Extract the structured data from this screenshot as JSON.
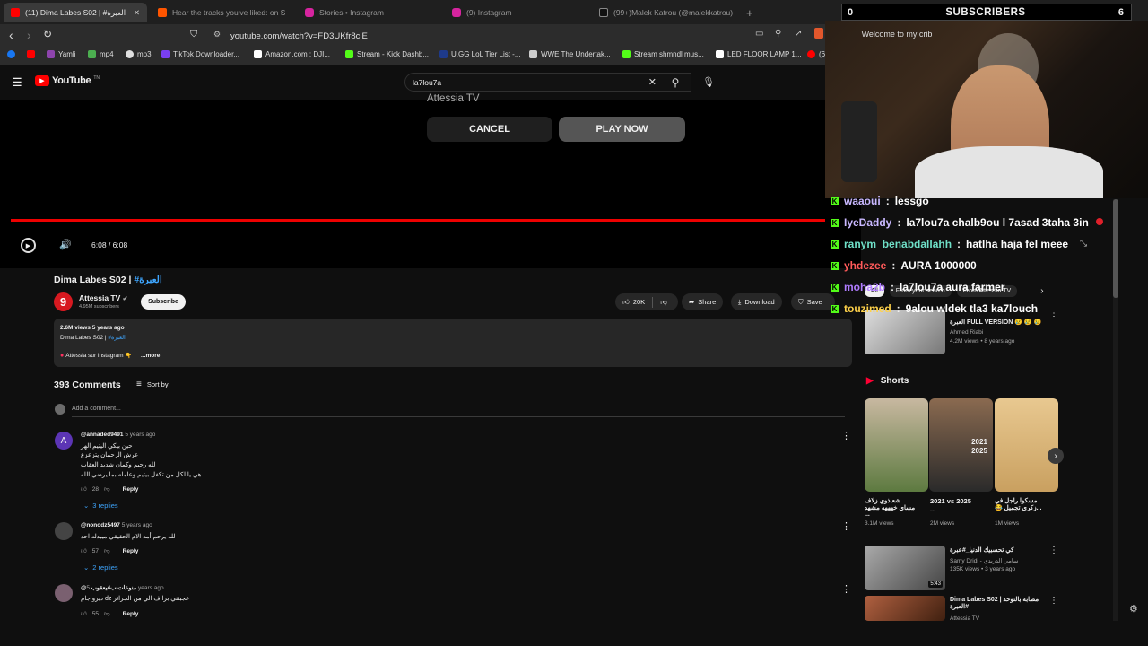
{
  "tabs": [
    {
      "label": "(11) Dima Labes S02 | #العبرة"
    },
    {
      "label": "Hear the tracks you've liked: on S"
    },
    {
      "label": "Stories • Instagram"
    },
    {
      "label": "(9) Instagram"
    },
    {
      "label": "(99+)Malek Katrou (@malekkatrou) |"
    },
    {
      "label": "+"
    }
  ],
  "address": {
    "url": "youtube.com/watch?v=FD3UKfr8clE"
  },
  "bookmarks": [
    {
      "label": "Yamli",
      "color": "#8e44ad"
    },
    {
      "label": "mp4",
      "color": "#4caf50"
    },
    {
      "label": "mp3",
      "color": "#e0e0e0"
    },
    {
      "label": "TikTok Downloader...",
      "color": "#7a3ff2"
    },
    {
      "label": "Amazon.com : DJI...",
      "color": "#ffffff"
    },
    {
      "label": "Stream - Kick Dashb...",
      "color": "#53fc18"
    },
    {
      "label": "U.GG LoL Tier List -...",
      "color": "#1e3a8a"
    },
    {
      "label": "WWE The Undertak...",
      "color": "#cccccc"
    },
    {
      "label": "Stream shmndl mus...",
      "color": "#53fc18"
    },
    {
      "label": "LED FLOOR LAMP 1...",
      "color": "#ffffff"
    }
  ],
  "bookmark_tail": "(6",
  "yt": {
    "logo": "YouTube",
    "logo_sup": "TN",
    "search_value": "la7lou7a"
  },
  "player": {
    "upnext_channel": "Attessia TV",
    "cancel": "CANCEL",
    "play_now": "PLAY NOW",
    "time": "6:08 / 6:08",
    "progress_fraction": 1.0
  },
  "video": {
    "title_prefix": "Dima Labes S02 | ",
    "title_tag": "#العبرة",
    "channel": "Attessia TV",
    "channel_badge": "9",
    "subscribers": "4.95M subscribers",
    "subscribe": "Subscribe",
    "likes": "20K",
    "share": "Share",
    "download": "Download",
    "save": "Save",
    "views": "2.6M views  5 years ago",
    "desc_line": "Dima Labes S02 | ",
    "desc_tag": "#العبرة",
    "desc_insta": "Attessia sur instagram",
    "more": "...more"
  },
  "comments": {
    "count": "393 Comments",
    "sort": "Sort by",
    "add_placeholder": "Add a comment...",
    "items": [
      {
        "avatar": "A",
        "avatar_color": "#5c35b5",
        "user": "@annaded9491",
        "time": "5 years ago",
        "lines": [
          "حين بيكي اليتيم الهر",
          "عرش الرحمان يتزعزع",
          "لله رحيم وكمان شديد العقاب",
          "هي يا لكل من تكفل بيتيم وعامله بما يرضي الله"
        ],
        "likes": "28",
        "reply": "Reply",
        "replies": "3 replies"
      },
      {
        "avatar": "",
        "avatar_color": "#444444",
        "user": "@nonodz5497",
        "time": "5 years ago",
        "lines": [
          "لله يرحم أمه   الام الحقيقي ميبدله احد"
        ],
        "likes": "57",
        "reply": "Reply",
        "replies": "2 replies"
      },
      {
        "avatar": "",
        "avatar_color": "#7a6070",
        "user": "@منوعات-ب4يعقوب",
        "time": "5 years ago",
        "lines": [
          "عجبتني بزااف الي من الجزائر dz ديرو جام"
        ],
        "likes": "55",
        "reply": "Reply",
        "replies": ""
      }
    ]
  },
  "overlay": {
    "left_count": "0",
    "label": "SUBSCRIBERS",
    "right_count": "6",
    "sign": "Welcome to my crib"
  },
  "chat": [
    {
      "user": "waaoui",
      "msg": "lessgo",
      "color": "#c9b8ff"
    },
    {
      "user": "IyeDaddy",
      "msg": "la7lou7a chalb9ou l 7asad 3taha 3in",
      "color": "#c9b8ff"
    },
    {
      "user": "ranym_benabdallahh",
      "msg": "hatlha haja fel meee",
      "color": "#6fe0c8"
    },
    {
      "user": "yhdezee",
      "msg": "AURA 1000000",
      "color": "#ff5a5a"
    },
    {
      "user": "moha2b",
      "msg": "la7lou7a aura farmer",
      "color": "#b07cff"
    },
    {
      "user": "touzimed",
      "msg": "9alou wldek tla3 ka7louch",
      "color": "#ffd24a"
    }
  ],
  "sidebar": {
    "chips": [
      "All",
      "From your search",
      "From Attessia TV"
    ],
    "video1": {
      "title": "العبرة FULL VERSION 😢 😢 😢",
      "channel": "Ahmed Riabi",
      "meta": "4.2M views • 8 years ago"
    },
    "shorts_title": "Shorts",
    "shorts": [
      {
        "title": "شعاذوي زلاف مساي خهههه مشهد ...",
        "views": "3.1M views",
        "color": "#c8b8a0"
      },
      {
        "title": "2021 vs 2025 ...",
        "views": "2M views",
        "color": "#8a6a50",
        "overlay": "2021 2025"
      },
      {
        "title": "مسكوا راجل في ...زكرى تجميل 😂",
        "views": "1M views",
        "color": "#e8c890"
      }
    ],
    "video2": {
      "title": "كي تحسبيك الدنيا_#عبرة",
      "channel": "Samy Dridi - سامي الدريدي",
      "meta": "135K views • 3 years ago",
      "duration": "5:43"
    },
    "video3": {
      "title": "Dima Labes S02 | مصابة بالتوحد #العبرة",
      "channel": "Attessia TV",
      "meta": ""
    }
  },
  "colors": {
    "accent": "#ff0000",
    "link": "#3ea6ff",
    "kick": "#53fc18"
  }
}
